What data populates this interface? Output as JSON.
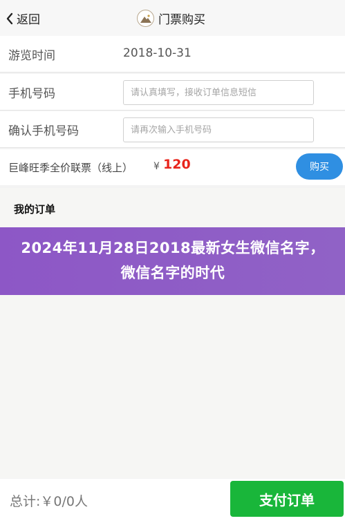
{
  "nav": {
    "back_label": "返回",
    "title": "门票购买"
  },
  "form": {
    "visit_time_label": "游览时间",
    "visit_time_value": "2018-10-31",
    "phone_label": "手机号码",
    "phone_placeholder": "请认真填写，接收订单信息短信",
    "confirm_phone_label": "确认手机号码",
    "confirm_phone_placeholder": "请再次输入手机号码"
  },
  "ticket": {
    "name": "巨峰旺季全价联票（线上）",
    "currency": "¥",
    "price": "120",
    "buy_label": "购买"
  },
  "orders": {
    "title": "我的订单"
  },
  "banner": {
    "text": "2024年11月28日2018最新女生微信名字，微信名字的时代"
  },
  "footer": {
    "total_label": "总计:￥0/0人",
    "pay_label": "支付订单"
  },
  "colors": {
    "accent_blue": "#2f8fe2",
    "price_red": "#e8251c",
    "pay_green": "#19b63a",
    "banner_purple": "#8d57c6"
  }
}
